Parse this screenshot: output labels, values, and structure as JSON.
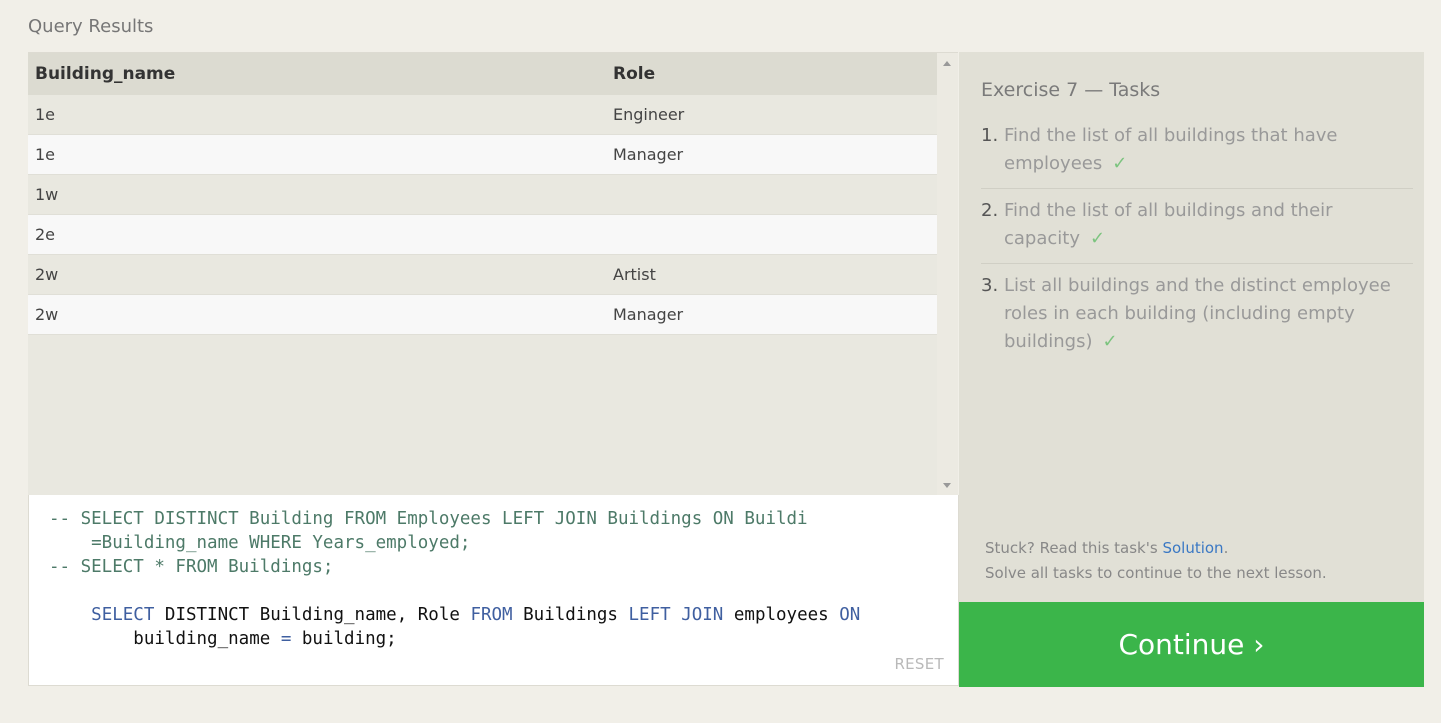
{
  "section_title": "Query Results",
  "table": {
    "headers": [
      "Building_name",
      "Role"
    ],
    "rows": [
      [
        "1e",
        "Engineer"
      ],
      [
        "1e",
        "Manager"
      ],
      [
        "1w",
        ""
      ],
      [
        "2e",
        ""
      ],
      [
        "2w",
        "Artist"
      ],
      [
        "2w",
        "Manager"
      ]
    ]
  },
  "editor": {
    "lines": [
      "-- SELECT DISTINCT Building FROM Employees LEFT JOIN Buildings ON Buildi",
      "    =Building_name WHERE Years_employed;",
      "-- SELECT * FROM Buildings;"
    ],
    "query_line1": {
      "kw1": "SELECT",
      "t1": " DISTINCT Building_name, Role ",
      "kw2": "FROM",
      "t2": " Buildings ",
      "kw3": "LEFT JOIN",
      "t3": " employees ",
      "kw4": "ON"
    },
    "query_line2": {
      "t1": "    building_name ",
      "op": "=",
      "t2": " building;"
    },
    "reset_label": "RESET"
  },
  "tasks": {
    "title": "Exercise 7 — Tasks",
    "items": [
      {
        "num": "1.",
        "text": "Find the list of all buildings that have employees",
        "check": "✓"
      },
      {
        "num": "2.",
        "text": "Find the list of all buildings and their capacity",
        "check": "✓"
      },
      {
        "num": "3.",
        "text": "List all buildings and the distinct employee roles in each building (including empty buildings)",
        "check": "✓"
      }
    ],
    "stuck_prefix": "Stuck? Read this task's ",
    "solution_link": "Solution",
    "stuck_suffix": ".",
    "hint": "Solve all tasks to continue to the next lesson."
  },
  "continue_label": "Continue ›",
  "colors": {
    "accent_green": "#3bb54a",
    "link_blue": "#3a78c4",
    "check_green": "#7cc47f"
  }
}
